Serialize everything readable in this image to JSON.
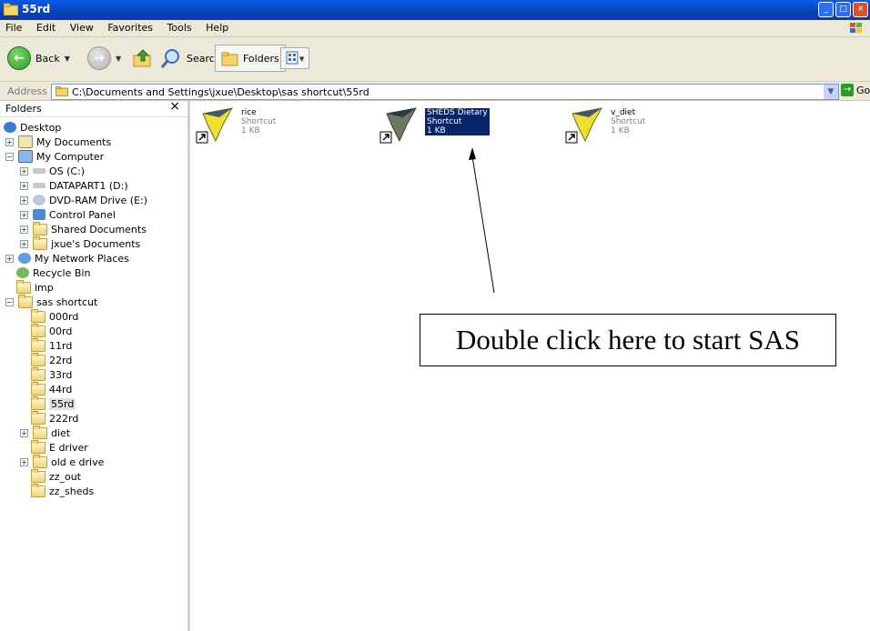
{
  "window": {
    "title": "55rd"
  },
  "menu": [
    "File",
    "Edit",
    "View",
    "Favorites",
    "Tools",
    "Help"
  ],
  "toolbar": {
    "back": "Back",
    "search": "Search",
    "folders": "Folders"
  },
  "address": {
    "label": "Address",
    "value": "C:\\Documents and Settings\\jxue\\Desktop\\sas shortcut\\55rd",
    "go": "Go"
  },
  "folders_pane": {
    "title": "Folders",
    "items": [
      {
        "label": "Desktop"
      },
      {
        "label": "My Documents"
      },
      {
        "label": "My Computer"
      },
      {
        "label": "OS (C:)"
      },
      {
        "label": "DATAPART1 (D:)"
      },
      {
        "label": "DVD-RAM Drive (E:)"
      },
      {
        "label": "Control Panel"
      },
      {
        "label": "Shared Documents"
      },
      {
        "label": "jxue's Documents"
      },
      {
        "label": "My Network Places"
      },
      {
        "label": "Recycle Bin"
      },
      {
        "label": "imp"
      },
      {
        "label": "sas shortcut"
      },
      {
        "label": "000rd"
      },
      {
        "label": "00rd"
      },
      {
        "label": "11rd"
      },
      {
        "label": "22rd"
      },
      {
        "label": "33rd"
      },
      {
        "label": "44rd"
      },
      {
        "label": "55rd"
      },
      {
        "label": "222rd"
      },
      {
        "label": "diet"
      },
      {
        "label": "E driver"
      },
      {
        "label": "old e drive"
      },
      {
        "label": "zz_out"
      },
      {
        "label": "zz_sheds"
      }
    ]
  },
  "files": [
    {
      "name": "rice",
      "type": "Shortcut",
      "size": "1 KB"
    },
    {
      "name": "SHEDS Dietary",
      "type": "Shortcut",
      "size": "1 KB"
    },
    {
      "name": "v_diet",
      "type": "Shortcut",
      "size": "1 KB"
    }
  ],
  "annotation": {
    "text": "Double click here to start SAS"
  }
}
